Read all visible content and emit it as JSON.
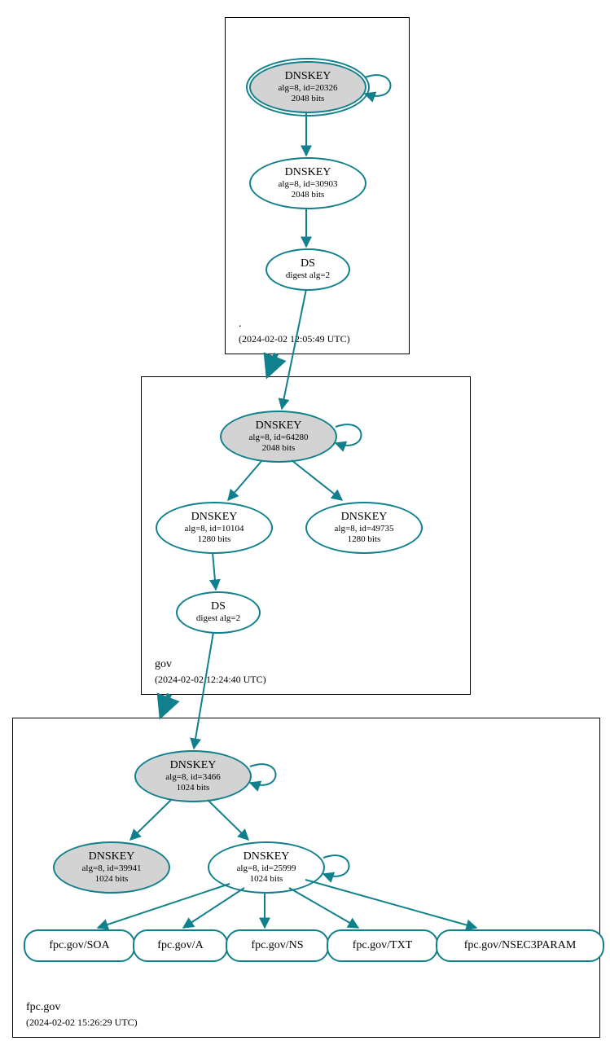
{
  "zones": {
    "root": {
      "label": ".",
      "timestamp": "(2024-02-02 12:05:49 UTC)"
    },
    "gov": {
      "label": "gov",
      "timestamp": "(2024-02-02 12:24:40 UTC)"
    },
    "fpc": {
      "label": "fpc.gov",
      "timestamp": "(2024-02-02 15:26:29 UTC)"
    }
  },
  "nodes": {
    "root_ksk": {
      "title": "DNSKEY",
      "line1": "alg=8, id=20326",
      "line2": "2048 bits"
    },
    "root_zsk": {
      "title": "DNSKEY",
      "line1": "alg=8, id=30903",
      "line2": "2048 bits"
    },
    "root_ds": {
      "title": "DS",
      "line1": "digest alg=2"
    },
    "gov_ksk": {
      "title": "DNSKEY",
      "line1": "alg=8, id=64280",
      "line2": "2048 bits"
    },
    "gov_zsk1": {
      "title": "DNSKEY",
      "line1": "alg=8, id=10104",
      "line2": "1280 bits"
    },
    "gov_zsk2": {
      "title": "DNSKEY",
      "line1": "alg=8, id=49735",
      "line2": "1280 bits"
    },
    "gov_ds": {
      "title": "DS",
      "line1": "digest alg=2"
    },
    "fpc_ksk": {
      "title": "DNSKEY",
      "line1": "alg=8, id=3466",
      "line2": "1024 bits"
    },
    "fpc_sep": {
      "title": "DNSKEY",
      "line1": "alg=8, id=39941",
      "line2": "1024 bits"
    },
    "fpc_zsk": {
      "title": "DNSKEY",
      "line1": "alg=8, id=25999",
      "line2": "1024 bits"
    }
  },
  "rr": {
    "soa": "fpc.gov/SOA",
    "a": "fpc.gov/A",
    "ns": "fpc.gov/NS",
    "txt": "fpc.gov/TXT",
    "nsec3": "fpc.gov/NSEC3PARAM"
  }
}
